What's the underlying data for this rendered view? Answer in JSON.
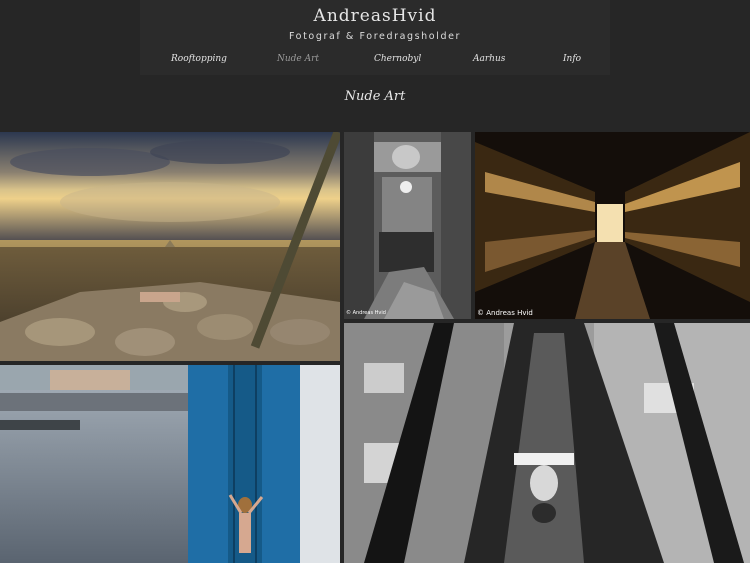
{
  "header": {
    "title": "AndreasHvid",
    "subtitle": "Fotograf & Foredragsholder"
  },
  "nav": {
    "items": [
      {
        "label": "Rooftopping",
        "active": false
      },
      {
        "label": "Nude Art",
        "active": true
      },
      {
        "label": "Chernobyl",
        "active": false
      },
      {
        "label": "Aarhus",
        "active": false
      },
      {
        "label": "Info",
        "active": false
      }
    ]
  },
  "page": {
    "heading": "Nude Art"
  },
  "gallery": {
    "photos": [
      {
        "subject": "pyramid-rooftop-night"
      },
      {
        "subject": "abandoned-building-bw",
        "watermark": "© Andreas Hvid"
      },
      {
        "subject": "tunnel-pipes",
        "watermark": "© Andreas Hvid"
      },
      {
        "subject": "harbor-blue-crane"
      },
      {
        "subject": "crane-top-bw"
      }
    ]
  }
}
